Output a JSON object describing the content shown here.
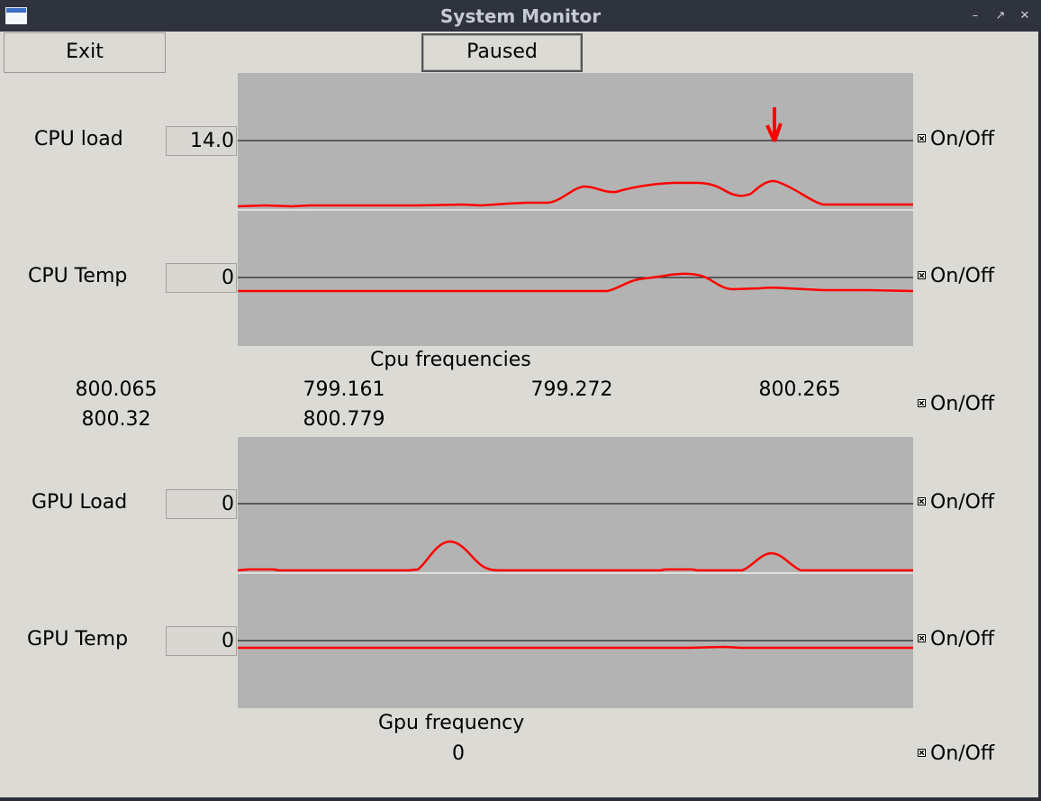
{
  "window": {
    "title": "System Monitor"
  },
  "toolbar": {
    "exit_label": "Exit",
    "paused_label": "Paused"
  },
  "cpu": {
    "load_label": "CPU load",
    "load_value": "14.0",
    "temp_label": "CPU Temp",
    "temp_value": "0",
    "freq_title": "Cpu frequencies",
    "frequencies": [
      "800.065",
      "799.161",
      "799.272",
      "800.265",
      "800.32",
      "800.779"
    ]
  },
  "gpu": {
    "load_label": "GPU Load",
    "load_value": "0",
    "temp_label": "GPU Temp",
    "temp_value": "0",
    "freq_title": "Gpu frequency",
    "frequency": "0"
  },
  "toggle_label": "On/Off",
  "colors": {
    "trace": "#ff0000",
    "graph_bg": "#b3b3b3",
    "window_bg": "#dcdad5",
    "titlebar": "#2f333d"
  }
}
